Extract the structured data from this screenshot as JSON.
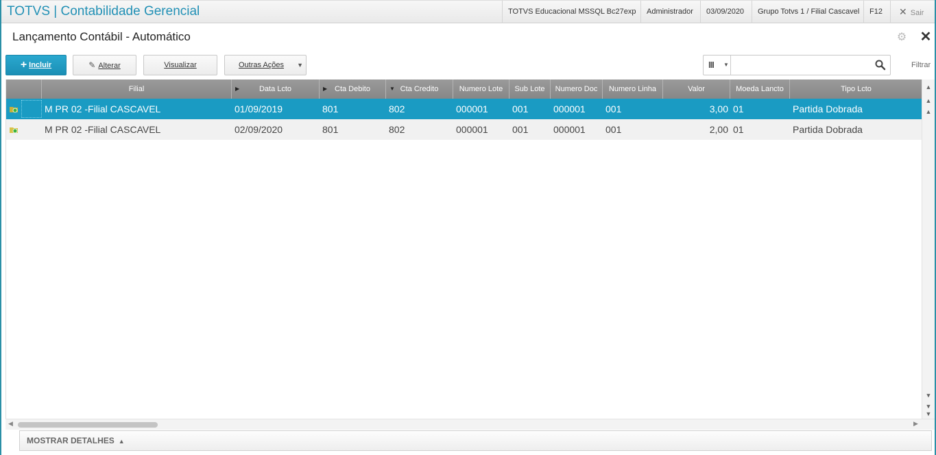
{
  "topbar": {
    "title": "TOTVS | Contabilidade Gerencial",
    "environment": "TOTVS Educacional MSSQL Bc27exp",
    "user": "Administrador",
    "date": "03/09/2020",
    "group": "Grupo Totvs 1 / Filial Cascavel",
    "shortcut": "F12",
    "exit_label": "Sair"
  },
  "page": {
    "title": "Lançamento Contábil - Automático"
  },
  "toolbar": {
    "include_label": "Incluir",
    "alter_label": "Alterar",
    "view_label": "Visualizar",
    "more_label": "Outras Ações",
    "filter_label": "Filtrar",
    "search_placeholder": ""
  },
  "grid": {
    "columns": [
      "",
      "Filial",
      "Data Lcto",
      "Cta Debito",
      "Cta Credito",
      "Numero Lote",
      "Sub Lote",
      "Numero Doc",
      "Numero Linha",
      "Valor",
      "Moeda Lancto",
      "Tipo Lcto"
    ],
    "rows": [
      {
        "filial": "M PR 02 -Filial CASCAVEL",
        "data": "01/09/2019",
        "debito": "801",
        "credito": "802",
        "lote": "000001",
        "sublote": "001",
        "doc": "000001",
        "linha": "001",
        "valor": "3,00",
        "moeda": "01",
        "tipo": "Partida Dobrada",
        "selected": true
      },
      {
        "filial": "M PR 02 -Filial CASCAVEL",
        "data": "02/09/2020",
        "debito": "801",
        "credito": "802",
        "lote": "000001",
        "sublote": "001",
        "doc": "000001",
        "linha": "001",
        "valor": "2,00",
        "moeda": "01",
        "tipo": "Partida Dobrada",
        "selected": false
      }
    ]
  },
  "details": {
    "label": "MOSTRAR DETALHES"
  },
  "colors": {
    "accent": "#1a9bc3",
    "header": "#8f8f8f",
    "title": "#2190b5"
  }
}
